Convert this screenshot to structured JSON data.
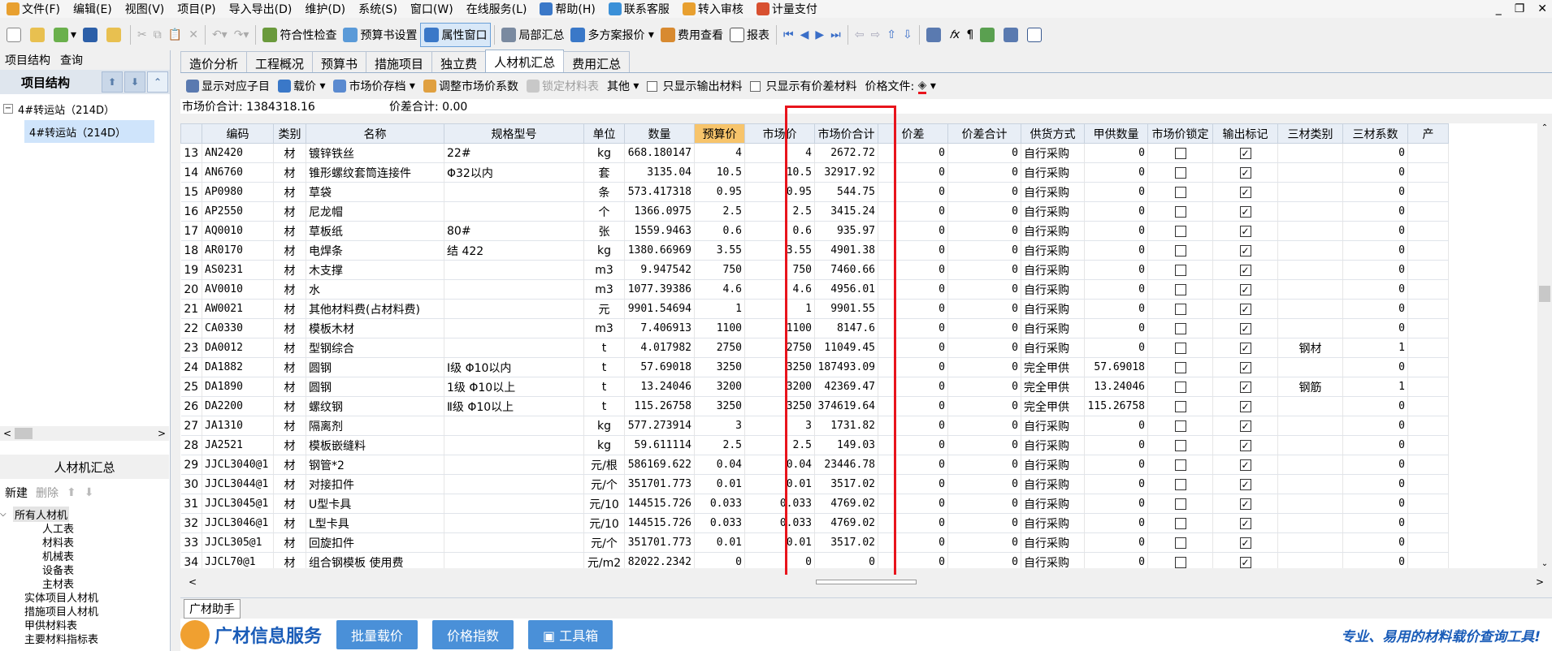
{
  "menu": [
    {
      "label": "文件(F)",
      "icon": "file-icon"
    },
    {
      "label": "编辑(E)",
      "icon": ""
    },
    {
      "label": "视图(V)",
      "icon": ""
    },
    {
      "label": "项目(P)",
      "icon": ""
    },
    {
      "label": "导入导出(D)",
      "icon": ""
    },
    {
      "label": "维护(D)",
      "icon": ""
    },
    {
      "label": "系统(S)",
      "icon": ""
    },
    {
      "label": "窗口(W)",
      "icon": ""
    },
    {
      "label": "在线服务(L)",
      "icon": ""
    },
    {
      "label": "帮助(H)",
      "icon": "help-icon"
    },
    {
      "label": "联系客服",
      "icon": "service-icon"
    },
    {
      "label": "转入审核",
      "icon": "audit-icon"
    },
    {
      "label": "计量支付",
      "icon": "payment-icon"
    }
  ],
  "toolbar": {
    "conformity_check": "符合性检查",
    "budget_settings": "预算书设置",
    "property_window": "属性窗口",
    "partial_summary": "局部汇总",
    "multi_quote": "多方案报价",
    "cost_view": "费用查看",
    "report": "报表"
  },
  "left": {
    "tab_structure": "项目结构",
    "tab_query": "查询",
    "header": "项目结构",
    "tree": [
      {
        "label": "4#转运站（214D）"
      },
      {
        "label": "4#转运站（214D）"
      }
    ],
    "rcj_title": "人材机汇总",
    "new_label": "新建",
    "delete_label": "删除",
    "rcj_tree": [
      "所有人材机",
      "人工表",
      "材料表",
      "机械表",
      "设备表",
      "主材表",
      "实体项目人材机",
      "措施项目人材机",
      "甲供材料表",
      "主要材料指标表"
    ]
  },
  "tabs": [
    "造价分析",
    "工程概况",
    "预算书",
    "措施项目",
    "独立费",
    "人材机汇总",
    "费用汇总"
  ],
  "subbar": {
    "show_sub": "显示对应子目",
    "load_price": "载价",
    "market_archive": "市场价存档",
    "adjust_coef": "调整市场价系数",
    "lock_qty": "锁定材料表",
    "other": "其他",
    "only_output": "只显示输出材料",
    "only_diff": "只显示有价差材料",
    "price_file": "价格文件:"
  },
  "summary": {
    "market_total": "市场价合计: 1384318.16",
    "diff_total": "价差合计: 0.00"
  },
  "columns": [
    "编码",
    "类别",
    "名称",
    "规格型号",
    "单位",
    "数量",
    "预算价",
    "市场价",
    "市场价合计",
    "价差",
    "价差合计",
    "供货方式",
    "甲供数量",
    "市场价锁定",
    "输出标记",
    "三材类别",
    "三材系数",
    "产"
  ],
  "rows": [
    {
      "no": "13",
      "code": "AN2420",
      "type": "材",
      "name": "镀锌铁丝",
      "spec": "22#",
      "unit": "kg",
      "qty": "668.180147",
      "budget": "4",
      "market": "4",
      "total": "2672.72",
      "diff": "0",
      "difftotal": "0",
      "supply": "自行采购",
      "jia": "0",
      "lock": false,
      "out": true,
      "sancai": "",
      "coef": "0"
    },
    {
      "no": "14",
      "code": "AN6760",
      "type": "材",
      "name": "锥形螺纹套筒连接件",
      "spec": "Φ32以内",
      "unit": "套",
      "qty": "3135.04",
      "budget": "10.5",
      "market": "10.5",
      "total": "32917.92",
      "diff": "0",
      "difftotal": "0",
      "supply": "自行采购",
      "jia": "0",
      "lock": false,
      "out": true,
      "sancai": "",
      "coef": "0"
    },
    {
      "no": "15",
      "code": "AP0980",
      "type": "材",
      "name": "草袋",
      "spec": "",
      "unit": "条",
      "qty": "573.417318",
      "budget": "0.95",
      "market": "0.95",
      "total": "544.75",
      "diff": "0",
      "difftotal": "0",
      "supply": "自行采购",
      "jia": "0",
      "lock": false,
      "out": true,
      "sancai": "",
      "coef": "0"
    },
    {
      "no": "16",
      "code": "AP2550",
      "type": "材",
      "name": "尼龙帽",
      "spec": "",
      "unit": "个",
      "qty": "1366.0975",
      "budget": "2.5",
      "market": "2.5",
      "total": "3415.24",
      "diff": "0",
      "difftotal": "0",
      "supply": "自行采购",
      "jia": "0",
      "lock": false,
      "out": true,
      "sancai": "",
      "coef": "0"
    },
    {
      "no": "17",
      "code": "AQ0010",
      "type": "材",
      "name": "草板纸",
      "spec": "80#",
      "unit": "张",
      "qty": "1559.9463",
      "budget": "0.6",
      "market": "0.6",
      "total": "935.97",
      "diff": "0",
      "difftotal": "0",
      "supply": "自行采购",
      "jia": "0",
      "lock": false,
      "out": true,
      "sancai": "",
      "coef": "0"
    },
    {
      "no": "18",
      "code": "AR0170",
      "type": "材",
      "name": "电焊条",
      "spec": "结 422",
      "unit": "kg",
      "qty": "1380.66969",
      "budget": "3.55",
      "market": "3.55",
      "total": "4901.38",
      "diff": "0",
      "difftotal": "0",
      "supply": "自行采购",
      "jia": "0",
      "lock": false,
      "out": true,
      "sancai": "",
      "coef": "0"
    },
    {
      "no": "19",
      "code": "AS0231",
      "type": "材",
      "name": "木支撑",
      "spec": "",
      "unit": "m3",
      "qty": "9.947542",
      "budget": "750",
      "market": "750",
      "total": "7460.66",
      "diff": "0",
      "difftotal": "0",
      "supply": "自行采购",
      "jia": "0",
      "lock": false,
      "out": true,
      "sancai": "",
      "coef": "0"
    },
    {
      "no": "20",
      "code": "AV0010",
      "type": "材",
      "name": "水",
      "spec": "",
      "unit": "m3",
      "qty": "1077.39386",
      "budget": "4.6",
      "market": "4.6",
      "total": "4956.01",
      "diff": "0",
      "difftotal": "0",
      "supply": "自行采购",
      "jia": "0",
      "lock": false,
      "out": true,
      "sancai": "",
      "coef": "0"
    },
    {
      "no": "21",
      "code": "AW0021",
      "type": "材",
      "name": "其他材料费(占材料费)",
      "spec": "",
      "unit": "元",
      "qty": "9901.54694",
      "budget": "1",
      "market": "1",
      "total": "9901.55",
      "diff": "0",
      "difftotal": "0",
      "supply": "自行采购",
      "jia": "0",
      "lock": false,
      "out": true,
      "sancai": "",
      "coef": "0"
    },
    {
      "no": "22",
      "code": "CA0330",
      "type": "材",
      "name": "模板木材",
      "spec": "",
      "unit": "m3",
      "qty": "7.406913",
      "budget": "1100",
      "market": "1100",
      "total": "8147.6",
      "diff": "0",
      "difftotal": "0",
      "supply": "自行采购",
      "jia": "0",
      "lock": false,
      "out": true,
      "sancai": "",
      "coef": "0"
    },
    {
      "no": "23",
      "code": "DA0012",
      "type": "材",
      "name": "型钢综合",
      "spec": "",
      "unit": "t",
      "qty": "4.017982",
      "budget": "2750",
      "market": "2750",
      "total": "11049.45",
      "diff": "0",
      "difftotal": "0",
      "supply": "自行采购",
      "jia": "0",
      "lock": false,
      "out": true,
      "sancai": "钢材",
      "coef": "1"
    },
    {
      "no": "24",
      "code": "DA1882",
      "type": "材",
      "name": "圆钢",
      "spec": "Ⅰ级 Φ10以内",
      "unit": "t",
      "qty": "57.69018",
      "budget": "3250",
      "market": "3250",
      "total": "187493.09",
      "diff": "0",
      "difftotal": "0",
      "supply": "完全甲供",
      "jia": "57.69018",
      "lock": false,
      "out": true,
      "sancai": "",
      "coef": "0"
    },
    {
      "no": "25",
      "code": "DA1890",
      "type": "材",
      "name": "圆钢",
      "spec": "1级 Φ10以上",
      "unit": "t",
      "qty": "13.24046",
      "budget": "3200",
      "market": "3200",
      "total": "42369.47",
      "diff": "0",
      "difftotal": "0",
      "supply": "完全甲供",
      "jia": "13.24046",
      "lock": false,
      "out": true,
      "sancai": "钢筋",
      "coef": "1"
    },
    {
      "no": "26",
      "code": "DA2200",
      "type": "材",
      "name": "螺纹钢",
      "spec": "Ⅱ级 Φ10以上",
      "unit": "t",
      "qty": "115.26758",
      "budget": "3250",
      "market": "3250",
      "total": "374619.64",
      "diff": "0",
      "difftotal": "0",
      "supply": "完全甲供",
      "jia": "115.26758",
      "lock": false,
      "out": true,
      "sancai": "",
      "coef": "0"
    },
    {
      "no": "27",
      "code": "JA1310",
      "type": "材",
      "name": "隔离剂",
      "spec": "",
      "unit": "kg",
      "qty": "577.273914",
      "budget": "3",
      "market": "3",
      "total": "1731.82",
      "diff": "0",
      "difftotal": "0",
      "supply": "自行采购",
      "jia": "0",
      "lock": false,
      "out": true,
      "sancai": "",
      "coef": "0"
    },
    {
      "no": "28",
      "code": "JA2521",
      "type": "材",
      "name": "模板嵌缝料",
      "spec": "",
      "unit": "kg",
      "qty": "59.611114",
      "budget": "2.5",
      "market": "2.5",
      "total": "149.03",
      "diff": "0",
      "difftotal": "0",
      "supply": "自行采购",
      "jia": "0",
      "lock": false,
      "out": true,
      "sancai": "",
      "coef": "0"
    },
    {
      "no": "29",
      "code": "JJCL3040@1",
      "type": "材",
      "name": "钢管*2",
      "spec": "",
      "unit": "元/根",
      "qty": "586169.622",
      "budget": "0.04",
      "market": "0.04",
      "total": "23446.78",
      "diff": "0",
      "difftotal": "0",
      "supply": "自行采购",
      "jia": "0",
      "lock": false,
      "out": true,
      "sancai": "",
      "coef": "0"
    },
    {
      "no": "30",
      "code": "JJCL3044@1",
      "type": "材",
      "name": "对接扣件",
      "spec": "",
      "unit": "元/个",
      "qty": "351701.773",
      "budget": "0.01",
      "market": "0.01",
      "total": "3517.02",
      "diff": "0",
      "difftotal": "0",
      "supply": "自行采购",
      "jia": "0",
      "lock": false,
      "out": true,
      "sancai": "",
      "coef": "0"
    },
    {
      "no": "31",
      "code": "JJCL3045@1",
      "type": "材",
      "name": "U型卡具",
      "spec": "",
      "unit": "元/10",
      "qty": "144515.726",
      "budget": "0.033",
      "market": "0.033",
      "total": "4769.02",
      "diff": "0",
      "difftotal": "0",
      "supply": "自行采购",
      "jia": "0",
      "lock": false,
      "out": true,
      "sancai": "",
      "coef": "0"
    },
    {
      "no": "32",
      "code": "JJCL3046@1",
      "type": "材",
      "name": "L型卡具",
      "spec": "",
      "unit": "元/10",
      "qty": "144515.726",
      "budget": "0.033",
      "market": "0.033",
      "total": "4769.02",
      "diff": "0",
      "difftotal": "0",
      "supply": "自行采购",
      "jia": "0",
      "lock": false,
      "out": true,
      "sancai": "",
      "coef": "0"
    },
    {
      "no": "33",
      "code": "JJCL305@1",
      "type": "材",
      "name": "回旋扣件",
      "spec": "",
      "unit": "元/个",
      "qty": "351701.773",
      "budget": "0.01",
      "market": "0.01",
      "total": "3517.02",
      "diff": "0",
      "difftotal": "0",
      "supply": "自行采购",
      "jia": "0",
      "lock": false,
      "out": true,
      "sancai": "",
      "coef": "0"
    },
    {
      "no": "34",
      "code": "JJCL70@1",
      "type": "材",
      "name": "组合钢模板 使用费",
      "spec": "",
      "unit": "元/m2",
      "qty": "82022.2342",
      "budget": "0",
      "market": "0",
      "total": "0",
      "diff": "0",
      "difftotal": "0",
      "supply": "自行采购",
      "jia": "0",
      "lock": false,
      "out": true,
      "sancai": "",
      "coef": "0"
    }
  ],
  "helper_tab": "广材助手",
  "banner": {
    "brand": "广材信息服务",
    "btn1": "批量载价",
    "btn2": "价格指数",
    "btn3": "工具箱",
    "slogan": "专业、易用的材料载价查询工具!"
  },
  "colors": {
    "highlight_header": "#f7c46b",
    "selection_box": "#e8141c",
    "brand": "#1a5cb8"
  }
}
